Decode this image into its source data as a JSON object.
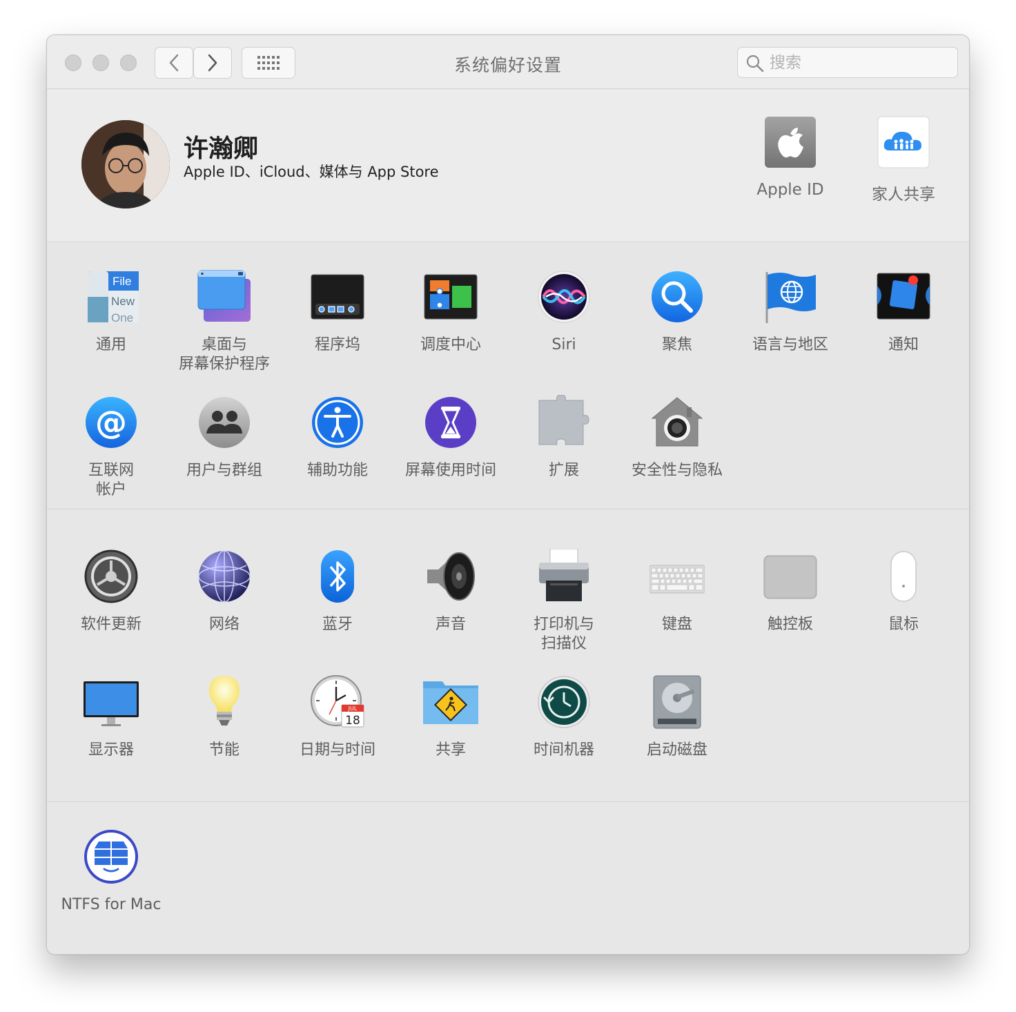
{
  "window": {
    "title": "系统偏好设置",
    "search_placeholder": "搜索"
  },
  "user": {
    "name": "许瀚卿",
    "subtitle": "Apple ID、iCloud、媒体与 App Store"
  },
  "account_items": [
    {
      "label": "Apple ID",
      "icon": "apple-id-icon"
    },
    {
      "label": "家人共享",
      "icon": "family-sharing-icon"
    }
  ],
  "personal_items": [
    {
      "label": "通用",
      "icon": "general-icon"
    },
    {
      "label": "桌面与\n屏幕保护程序",
      "icon": "desktop-screensaver-icon"
    },
    {
      "label": "程序坞",
      "icon": "dock-icon"
    },
    {
      "label": "调度中心",
      "icon": "mission-control-icon"
    },
    {
      "label": "Siri",
      "icon": "siri-icon"
    },
    {
      "label": "聚焦",
      "icon": "spotlight-icon"
    },
    {
      "label": "语言与地区",
      "icon": "language-region-icon"
    },
    {
      "label": "通知",
      "icon": "notifications-icon"
    },
    {
      "label": "互联网\n帐户",
      "icon": "internet-accounts-icon"
    },
    {
      "label": "用户与群组",
      "icon": "users-groups-icon"
    },
    {
      "label": "辅助功能",
      "icon": "accessibility-icon"
    },
    {
      "label": "屏幕使用时间",
      "icon": "screen-time-icon"
    },
    {
      "label": "扩展",
      "icon": "extensions-icon"
    },
    {
      "label": "安全性与隐私",
      "icon": "security-privacy-icon"
    }
  ],
  "hardware_items": [
    {
      "label": "软件更新",
      "icon": "software-update-icon"
    },
    {
      "label": "网络",
      "icon": "network-icon"
    },
    {
      "label": "蓝牙",
      "icon": "bluetooth-icon"
    },
    {
      "label": "声音",
      "icon": "sound-icon"
    },
    {
      "label": "打印机与\n扫描仪",
      "icon": "printers-scanners-icon"
    },
    {
      "label": "键盘",
      "icon": "keyboard-icon"
    },
    {
      "label": "触控板",
      "icon": "trackpad-icon"
    },
    {
      "label": "鼠标",
      "icon": "mouse-icon"
    },
    {
      "label": "显示器",
      "icon": "displays-icon"
    },
    {
      "label": "节能",
      "icon": "energy-saver-icon"
    },
    {
      "label": "日期与时间",
      "icon": "date-time-icon"
    },
    {
      "label": "共享",
      "icon": "sharing-icon"
    },
    {
      "label": "时间机器",
      "icon": "time-machine-icon"
    },
    {
      "label": "启动磁盘",
      "icon": "startup-disk-icon"
    }
  ],
  "other_items": [
    {
      "label": "NTFS for Mac",
      "icon": "ntfs-for-mac-icon"
    }
  ],
  "icon_text": {
    "general_file": "File",
    "general_new": "New",
    "general_one": "One",
    "calendar_month": "JUL",
    "calendar_day": "18"
  }
}
